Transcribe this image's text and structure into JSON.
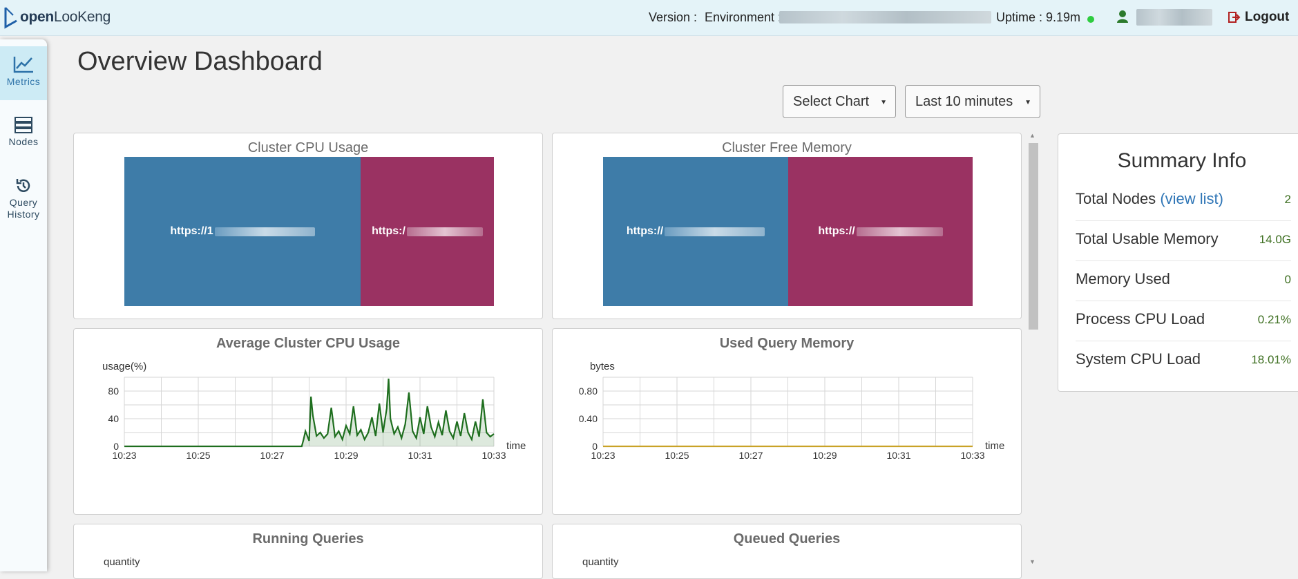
{
  "header": {
    "logo_text_bold": "open",
    "logo_text": "LooKeng",
    "version_label": "Version :",
    "environment_label": "Environment :",
    "uptime_label": "Uptime : 9.19m",
    "logout_label": "Logout"
  },
  "sidebar": {
    "items": [
      {
        "label": "Metrics",
        "icon": "chart-line-icon",
        "active": true
      },
      {
        "label": "Nodes",
        "icon": "server-stack-icon",
        "active": false
      },
      {
        "label": "Query",
        "label2": "History",
        "icon": "history-icon",
        "active": false
      }
    ]
  },
  "page_title": "Overview Dashboard",
  "controls": {
    "select_chart": "Select Chart",
    "time_range": "Last 10 minutes"
  },
  "panels": {
    "cpu_usage_title": "Cluster CPU Usage",
    "cpu_usage_blocks": [
      "https://1",
      "https:/"
    ],
    "free_memory_title": "Cluster Free Memory",
    "free_memory_blocks": [
      "https://",
      "https://"
    ],
    "avg_cpu_title": "Average Cluster CPU Usage",
    "avg_cpu_unit": "usage(%)",
    "used_mem_title": "Used Query Memory",
    "used_mem_unit": "bytes",
    "running_title": "Running Queries",
    "running_unit": "quantity",
    "queued_title": "Queued Queries",
    "queued_unit": "quantity"
  },
  "colors": {
    "treemap_blue": "#3e7ca8",
    "treemap_magenta": "#9a3262",
    "cpu_line": "#1e6e1e",
    "mem_line": "#c9a227"
  },
  "chart_data": [
    {
      "type": "area",
      "title": "Average Cluster CPU Usage",
      "ylabel": "usage(%)",
      "xlabel": "time",
      "ylim": [
        0,
        100
      ],
      "yticks": [
        0,
        40,
        80
      ],
      "xticks": [
        "10:23",
        "10:25",
        "10:27",
        "10:29",
        "10:31",
        "10:33"
      ],
      "grid": true,
      "series": [
        {
          "x": [
            23.0,
            27.8,
            27.85,
            27.9,
            28.0,
            28.05,
            28.1,
            28.2,
            28.3,
            28.4,
            28.5,
            28.6,
            28.7,
            28.8,
            28.9,
            29.0,
            29.1,
            29.2,
            29.3,
            29.4,
            29.5,
            29.6,
            29.7,
            29.8,
            29.9,
            30.0,
            30.1,
            30.15,
            30.2,
            30.3,
            30.4,
            30.5,
            30.6,
            30.7,
            30.8,
            30.9,
            31.0,
            31.1,
            31.2,
            31.3,
            31.4,
            31.5,
            31.6,
            31.7,
            31.8,
            31.9,
            32.0,
            32.1,
            32.2,
            32.3,
            32.4,
            32.5,
            32.6,
            32.7,
            32.8,
            32.9,
            33.0
          ],
          "y": [
            0,
            0,
            10,
            22,
            8,
            72,
            45,
            15,
            20,
            12,
            18,
            56,
            14,
            22,
            10,
            30,
            18,
            58,
            16,
            24,
            10,
            20,
            42,
            15,
            62,
            20,
            55,
            98,
            40,
            18,
            28,
            12,
            32,
            78,
            22,
            12,
            42,
            18,
            58,
            28,
            14,
            35,
            16,
            52,
            22,
            12,
            36,
            15,
            48,
            20,
            10,
            36,
            14,
            68,
            20,
            14,
            18
          ]
        }
      ]
    },
    {
      "type": "line",
      "title": "Used Query Memory",
      "ylabel": "bytes",
      "xlabel": "time",
      "ylim": [
        0,
        1
      ],
      "yticks": [
        "0",
        "0.40",
        "0.80"
      ],
      "xticks": [
        "10:23",
        "10:25",
        "10:27",
        "10:29",
        "10:31",
        "10:33"
      ],
      "grid": true,
      "series": [
        {
          "x": [
            23,
            33
          ],
          "y": [
            0,
            0
          ]
        }
      ]
    }
  ],
  "summary": {
    "title": "Summary Info",
    "rows": [
      {
        "label": "Total Nodes",
        "link": "(view list)",
        "value": "2"
      },
      {
        "label": "Total Usable Memory",
        "value": "14.0G"
      },
      {
        "label": "Memory Used",
        "value": "0"
      },
      {
        "label": "Process CPU Load",
        "value": "0.21%"
      },
      {
        "label": "System CPU Load",
        "value": "18.01%"
      }
    ]
  }
}
